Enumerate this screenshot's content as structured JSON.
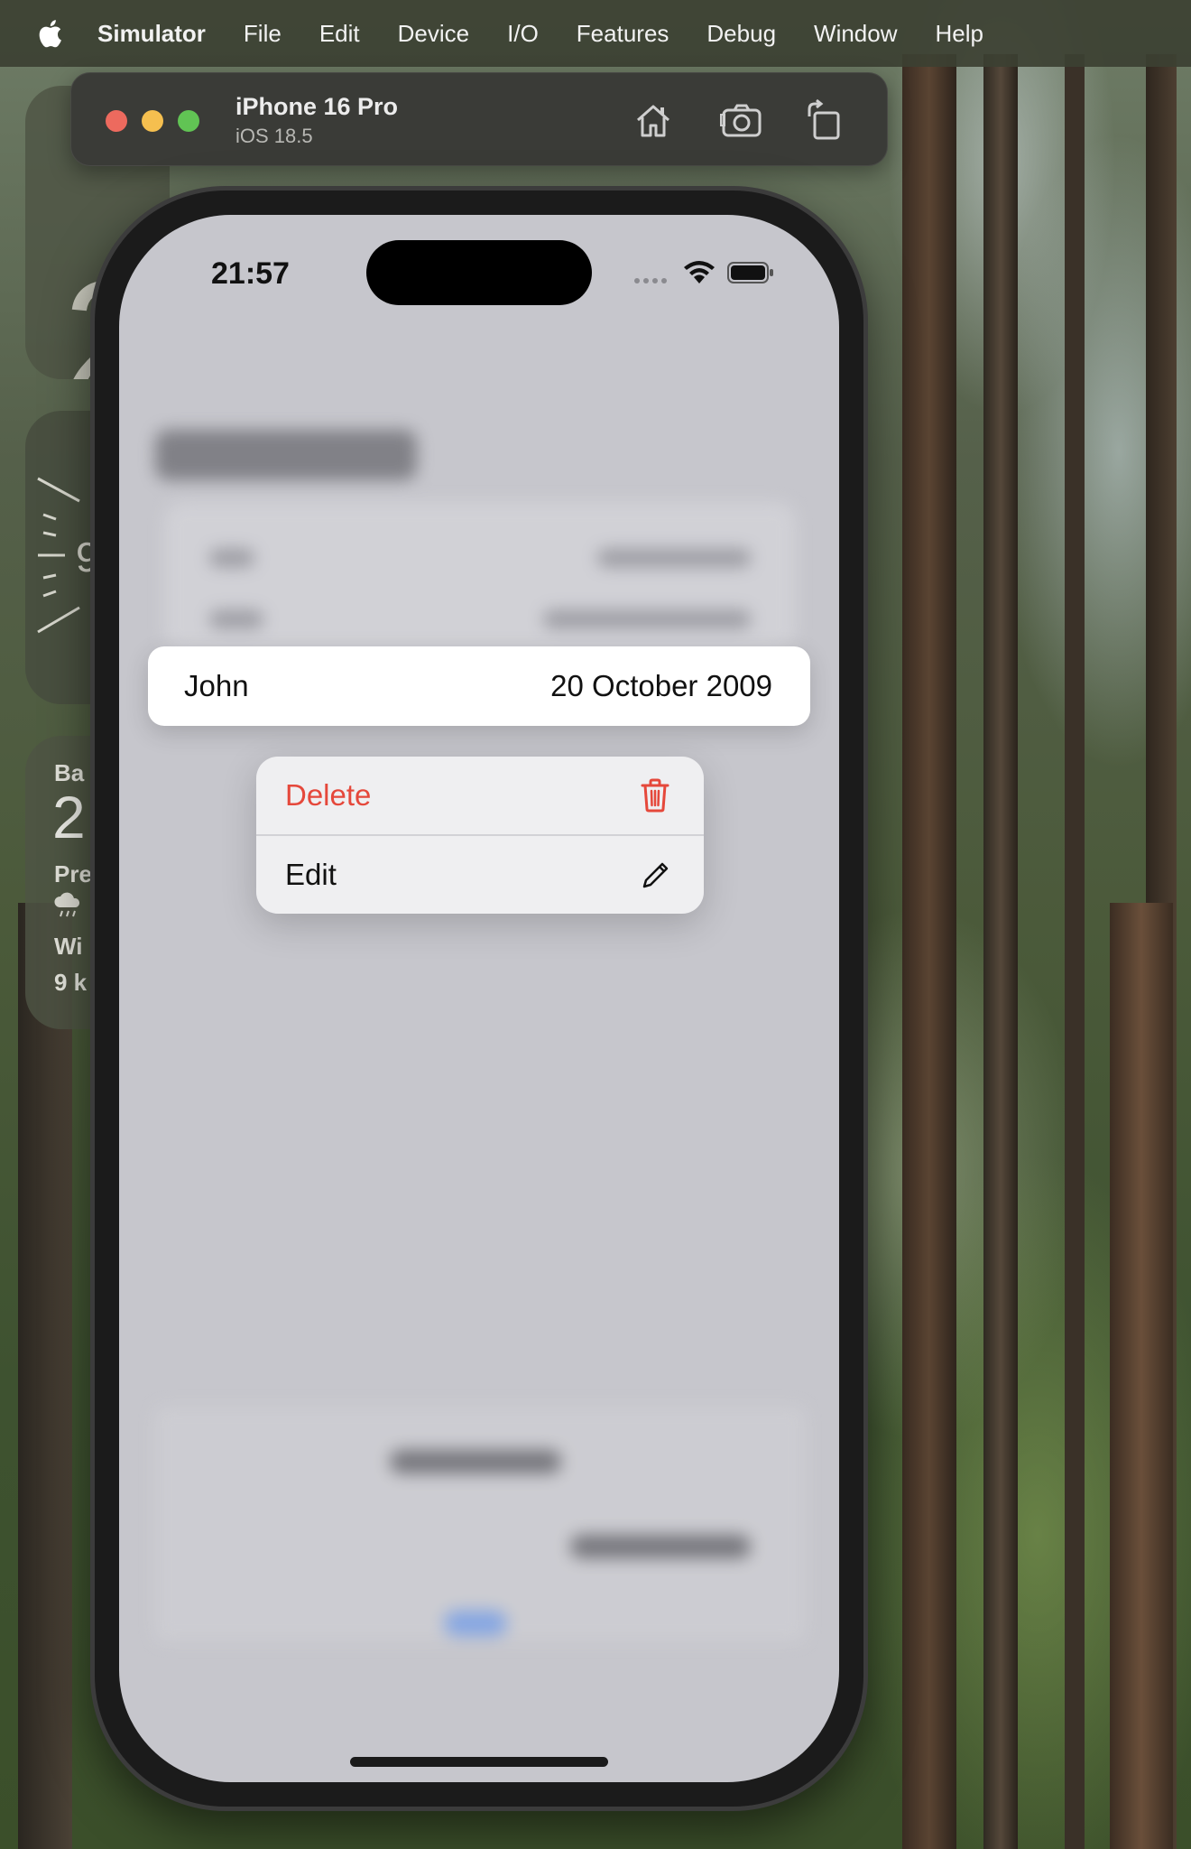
{
  "menubar": {
    "app_name": "Simulator",
    "items": [
      "File",
      "Edit",
      "Device",
      "I/O",
      "Features",
      "Debug",
      "Window",
      "Help"
    ]
  },
  "simulator": {
    "device_name": "iPhone 16 Pro",
    "os_version": "iOS 18.5",
    "toolbar_icons": [
      "home-icon",
      "screenshot-icon",
      "rotate-icon"
    ]
  },
  "widgets": {
    "weather_city_letter": "2",
    "clock_letter": "9",
    "bar_label": "Ba",
    "bar_value": "2",
    "pre_label": "Pre",
    "wind_label": "Wi",
    "wind_value": "9 k"
  },
  "status_bar": {
    "time": "21:57",
    "icons": [
      "signal-icon",
      "wifi-icon",
      "battery-icon"
    ]
  },
  "preview_row": {
    "name": "John",
    "date": "20 October 2009"
  },
  "context_menu": {
    "items": [
      {
        "label": "Delete",
        "icon": "trash-icon",
        "destructive": true,
        "color": "#e5483b"
      },
      {
        "label": "Edit",
        "icon": "pencil-icon",
        "destructive": false
      }
    ]
  }
}
